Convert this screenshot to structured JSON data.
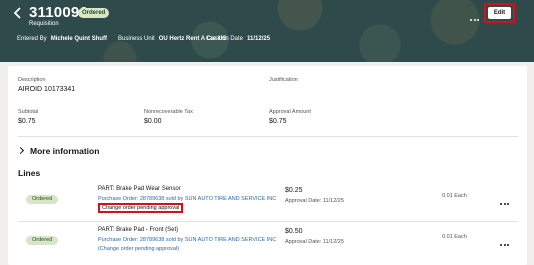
{
  "header": {
    "requisition_number": "3110096",
    "status": "Ordered",
    "subtitle": "Requisition",
    "entered_by_label": "Entered By",
    "entered_by": "Michele Quint Shuff",
    "business_unit_label": "Business Unit",
    "business_unit": "OU Hertz Rent A Car US",
    "creation_date_label": "Creation Date",
    "creation_date": "11/12/25",
    "edit_label": "Edit",
    "more_icon": "ellipsis-icon",
    "back_icon": "chevron-left-icon"
  },
  "summary": {
    "description_label": "Description",
    "description": "AIROID 10173341",
    "justification_label": "Justification",
    "subtotal_label": "Subtotal",
    "subtotal": "$0.75",
    "nonrecoverable_tax_label": "Nonrecoverable Tax",
    "nonrecoverable_tax": "$0.00",
    "approval_amount_label": "Approval Amount",
    "approval_amount": "$0.75"
  },
  "more_information": "More information",
  "lines_title": "Lines",
  "lines": [
    {
      "status": "Ordered",
      "name": "PART: Brake Pad Wear Sensor",
      "po": "Purchase Order: 28789638 sold by SUN AUTO TIRE AND SERVICE INC",
      "change": "Change order pending approval",
      "amount": "$0.25",
      "approval_date": "Approval Date: 11/12/25",
      "quantity": "0.01 Each"
    },
    {
      "status": "Ordered",
      "name": "PART: Brake Pad - Front (Set)",
      "po": "Purchase Order: 28789638 sold by SUN AUTO TIRE AND SERVICE INC",
      "change": "(Change order pending approval)",
      "amount": "$0.50",
      "approval_date": "Approval Date: 11/12/25",
      "quantity": "0.01 Each"
    }
  ],
  "colors": {
    "header_bg": "#2f4a4a",
    "status_bg": "#d7e6c8",
    "link": "#2a6aa8",
    "highlight": "#d4101c"
  }
}
